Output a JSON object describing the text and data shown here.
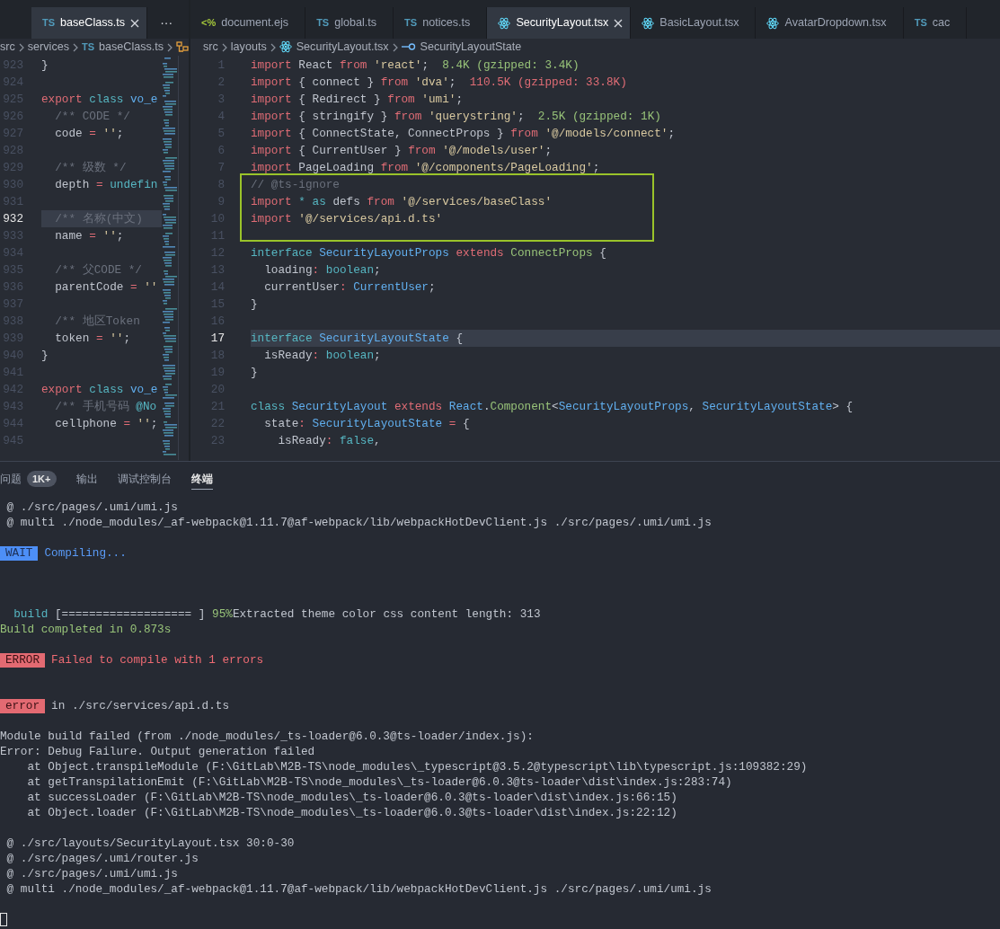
{
  "left_group": {
    "tabs": [
      {
        "label": "baseClass.ts",
        "icon": {
          "kind": "ts",
          "glyph": "TS"
        },
        "selected": true
      }
    ],
    "more_button": "···",
    "breadcrumb": [
      {
        "label": "src"
      },
      {
        "label": "services"
      },
      {
        "label": "baseClass.ts",
        "icon": {
          "kind": "ts",
          "glyph": "TS"
        }
      },
      {
        "icon": {
          "kind": "struct"
        }
      }
    ],
    "lines": [
      {
        "number": "923",
        "current": false,
        "tokens": [
          {
            "kind": "p",
            "text": "}"
          }
        ]
      },
      {
        "number": "924",
        "current": false
      },
      {
        "number": "925",
        "current": false,
        "tokens": [
          {
            "kind": "k",
            "text": "export"
          },
          {
            "kind": "c",
            "text": " class"
          },
          {
            "kind": "t",
            "text": " vo_e"
          }
        ]
      },
      {
        "number": "926",
        "current": false,
        "tokens": [
          {
            "kind": "cm",
            "text": "  /** CODE */"
          }
        ]
      },
      {
        "number": "927",
        "current": false,
        "tokens": [
          {
            "kind": "p",
            "text": "  code "
          },
          {
            "kind": "k",
            "text": "="
          },
          {
            "kind": "s",
            "text": " ''"
          },
          {
            "kind": "p",
            "text": ";"
          }
        ]
      },
      {
        "number": "928",
        "current": false
      },
      {
        "number": "929",
        "current": false,
        "tokens": [
          {
            "kind": "cm",
            "text": "  /** 级数 */"
          }
        ]
      },
      {
        "number": "930",
        "current": false,
        "tokens": [
          {
            "kind": "p",
            "text": "  depth "
          },
          {
            "kind": "k",
            "text": "="
          },
          {
            "kind": "c",
            "text": " undefin"
          }
        ]
      },
      {
        "number": "931",
        "current": false
      },
      {
        "number": "932",
        "current": true,
        "tokens": [
          {
            "kind": "cm",
            "text": "  /** 名称(中文)"
          }
        ]
      },
      {
        "number": "933",
        "current": false,
        "tokens": [
          {
            "kind": "p",
            "text": "  name "
          },
          {
            "kind": "k",
            "text": "="
          },
          {
            "kind": "s",
            "text": " ''"
          },
          {
            "kind": "p",
            "text": ";"
          }
        ]
      },
      {
        "number": "934",
        "current": false
      },
      {
        "number": "935",
        "current": false,
        "tokens": [
          {
            "kind": "cm",
            "text": "  /** 父CODE */"
          }
        ]
      },
      {
        "number": "936",
        "current": false,
        "tokens": [
          {
            "kind": "p",
            "text": "  parentCode "
          },
          {
            "kind": "k",
            "text": "="
          },
          {
            "kind": "s",
            "text": " ''"
          }
        ]
      },
      {
        "number": "937",
        "current": false
      },
      {
        "number": "938",
        "current": false,
        "tokens": [
          {
            "kind": "cm",
            "text": "  /** 地区Token"
          }
        ]
      },
      {
        "number": "939",
        "current": false,
        "tokens": [
          {
            "kind": "p",
            "text": "  token "
          },
          {
            "kind": "k",
            "text": "="
          },
          {
            "kind": "s",
            "text": " ''"
          },
          {
            "kind": "p",
            "text": ";"
          }
        ]
      },
      {
        "number": "940",
        "current": false,
        "tokens": [
          {
            "kind": "p",
            "text": "}"
          }
        ]
      },
      {
        "number": "941",
        "current": false
      },
      {
        "number": "942",
        "current": false,
        "tokens": [
          {
            "kind": "k",
            "text": "export"
          },
          {
            "kind": "c",
            "text": " class"
          },
          {
            "kind": "t",
            "text": " vo_e"
          }
        ]
      },
      {
        "number": "943",
        "current": false,
        "tokens": [
          {
            "kind": "cm",
            "text": "  /** 手机号码 "
          },
          {
            "kind": "c",
            "text": "@No"
          }
        ]
      },
      {
        "number": "944",
        "current": false,
        "tokens": [
          {
            "kind": "p",
            "text": "  cellphone "
          },
          {
            "kind": "k",
            "text": "="
          },
          {
            "kind": "s",
            "text": " ''"
          },
          {
            "kind": "p",
            "text": ";"
          }
        ]
      },
      {
        "number": "945",
        "current": false
      }
    ]
  },
  "right_group": {
    "tabs": [
      {
        "label": "document.ejs",
        "icon": {
          "kind": "ejs",
          "glyph": "<%"
        },
        "selected": false
      },
      {
        "label": "global.ts",
        "icon": {
          "kind": "ts",
          "glyph": "TS"
        },
        "selected": false
      },
      {
        "label": "notices.ts",
        "icon": {
          "kind": "ts",
          "glyph": "TS"
        },
        "selected": false
      },
      {
        "label": "SecurityLayout.tsx",
        "icon": {
          "kind": "react"
        },
        "selected": true
      },
      {
        "label": "BasicLayout.tsx",
        "icon": {
          "kind": "react"
        },
        "selected": false
      },
      {
        "label": "AvatarDropdown.tsx",
        "icon": {
          "kind": "react"
        },
        "selected": false
      },
      {
        "label": "cac",
        "icon": {
          "kind": "ts",
          "glyph": "TS"
        },
        "selected": false
      }
    ],
    "breadcrumb": [
      {
        "label": "src"
      },
      {
        "label": "layouts"
      },
      {
        "label": "SecurityLayout.tsx",
        "icon": {
          "kind": "react"
        }
      },
      {
        "label": "SecurityLayoutState",
        "icon": {
          "kind": "field"
        }
      }
    ],
    "lines": [
      {
        "kind": "line",
        "number": "1",
        "current": false,
        "tokens": [
          {
            "kind": "k",
            "text": "import"
          },
          {
            "kind": "p",
            "text": " React "
          },
          {
            "kind": "k",
            "text": "from"
          },
          {
            "kind": "s",
            "text": " 'react'"
          },
          {
            "kind": "p",
            "text": ";  "
          },
          {
            "kind": "sz",
            "text": "8.4K (gzipped: 3.4K)"
          }
        ]
      },
      {
        "kind": "line",
        "number": "2",
        "current": false,
        "tokens": [
          {
            "kind": "k",
            "text": "import"
          },
          {
            "kind": "p",
            "text": " { connect } "
          },
          {
            "kind": "k",
            "text": "from"
          },
          {
            "kind": "s",
            "text": " 'dva'"
          },
          {
            "kind": "p",
            "text": ";  "
          },
          {
            "kind": "szr",
            "text": "110.5K (gzipped: 33.8K)"
          }
        ]
      },
      {
        "kind": "line",
        "number": "3",
        "current": false,
        "tokens": [
          {
            "kind": "k",
            "text": "import"
          },
          {
            "kind": "p",
            "text": " { Redirect } "
          },
          {
            "kind": "k",
            "text": "from"
          },
          {
            "kind": "s",
            "text": " 'umi'"
          },
          {
            "kind": "p",
            "text": ";"
          }
        ]
      },
      {
        "kind": "line",
        "number": "4",
        "current": false,
        "tokens": [
          {
            "kind": "k",
            "text": "import"
          },
          {
            "kind": "p",
            "text": " { stringify } "
          },
          {
            "kind": "k",
            "text": "from"
          },
          {
            "kind": "s",
            "text": " 'querystring'"
          },
          {
            "kind": "p",
            "text": ";  "
          },
          {
            "kind": "sz",
            "text": "2.5K (gzipped: 1K)"
          }
        ]
      },
      {
        "kind": "line",
        "number": "5",
        "current": false,
        "tokens": [
          {
            "kind": "k",
            "text": "import"
          },
          {
            "kind": "p",
            "text": " { ConnectState, ConnectProps } "
          },
          {
            "kind": "k",
            "text": "from"
          },
          {
            "kind": "s",
            "text": " '@/models/connect'"
          },
          {
            "kind": "p",
            "text": ";"
          }
        ]
      },
      {
        "kind": "line",
        "number": "6",
        "current": false,
        "tokens": [
          {
            "kind": "k",
            "text": "import"
          },
          {
            "kind": "p",
            "text": " { CurrentUser } "
          },
          {
            "kind": "k",
            "text": "from"
          },
          {
            "kind": "s",
            "text": " '@/models/user'"
          },
          {
            "kind": "p",
            "text": ";"
          }
        ]
      },
      {
        "kind": "line",
        "number": "7",
        "current": false,
        "tokens": [
          {
            "kind": "k",
            "text": "import"
          },
          {
            "kind": "p",
            "text": " PageLoading "
          },
          {
            "kind": "k",
            "text": "from"
          },
          {
            "kind": "s",
            "text": " '@/components/PageLoading'"
          },
          {
            "kind": "p",
            "text": ";"
          }
        ]
      },
      {
        "kind": "boxed",
        "lines": [
          {
            "number": "8",
            "current": false,
            "tokens": [
              {
                "kind": "cm",
                "text": "// @ts-ignore"
              }
            ]
          },
          {
            "number": "9",
            "current": false,
            "tokens": [
              {
                "kind": "k",
                "text": "import"
              },
              {
                "kind": "c",
                "text": " *"
              },
              {
                "kind": "c",
                "text": " as"
              },
              {
                "kind": "p",
                "text": " defs "
              },
              {
                "kind": "k",
                "text": "from"
              },
              {
                "kind": "s",
                "text": " '@/services/baseClass'"
              }
            ]
          },
          {
            "number": "10",
            "current": false,
            "tokens": [
              {
                "kind": "k",
                "text": "import"
              },
              {
                "kind": "s",
                "text": " '@/services/api.d.ts'"
              }
            ]
          },
          {
            "number": "11",
            "current": false
          }
        ]
      },
      {
        "kind": "line",
        "number": "12",
        "current": false,
        "tokens": [
          {
            "kind": "c",
            "text": "interface"
          },
          {
            "kind": "t",
            "text": " SecurityLayoutProps"
          },
          {
            "kind": "k",
            "text": " extends"
          },
          {
            "kind": "g",
            "text": " ConnectProps"
          },
          {
            "kind": "p",
            "text": " {"
          }
        ]
      },
      {
        "kind": "line",
        "number": "13",
        "current": false,
        "tokens": [
          {
            "kind": "p",
            "text": "  loading"
          },
          {
            "kind": "k",
            "text": ":"
          },
          {
            "kind": "b",
            "text": " boolean"
          },
          {
            "kind": "p",
            "text": ";"
          }
        ]
      },
      {
        "kind": "line",
        "number": "14",
        "current": false,
        "tokens": [
          {
            "kind": "p",
            "text": "  currentUser"
          },
          {
            "kind": "k",
            "text": ":"
          },
          {
            "kind": "t",
            "text": " CurrentUser"
          },
          {
            "kind": "p",
            "text": ";"
          }
        ]
      },
      {
        "kind": "line",
        "number": "15",
        "current": false,
        "tokens": [
          {
            "kind": "p",
            "text": "}"
          }
        ]
      },
      {
        "kind": "line",
        "number": "16",
        "current": false
      },
      {
        "kind": "line",
        "number": "17",
        "current": true,
        "tokens": [
          {
            "kind": "c",
            "text": "interface"
          },
          {
            "kind": "t",
            "text": " SecurityLayoutState"
          },
          {
            "kind": "p",
            "text": " {"
          }
        ]
      },
      {
        "kind": "line",
        "number": "18",
        "current": false,
        "tokens": [
          {
            "kind": "p",
            "text": "  isReady"
          },
          {
            "kind": "k",
            "text": ":"
          },
          {
            "kind": "b",
            "text": " boolean"
          },
          {
            "kind": "p",
            "text": ";"
          }
        ]
      },
      {
        "kind": "line",
        "number": "19",
        "current": false,
        "tokens": [
          {
            "kind": "p",
            "text": "}"
          }
        ]
      },
      {
        "kind": "line",
        "number": "20",
        "current": false
      },
      {
        "kind": "line",
        "number": "21",
        "current": false,
        "tokens": [
          {
            "kind": "c",
            "text": "class"
          },
          {
            "kind": "t",
            "text": " SecurityLayout"
          },
          {
            "kind": "k",
            "text": " extends"
          },
          {
            "kind": "t",
            "text": " React"
          },
          {
            "kind": "p",
            "text": "."
          },
          {
            "kind": "g",
            "text": "Component"
          },
          {
            "kind": "p",
            "text": "<"
          },
          {
            "kind": "t",
            "text": "SecurityLayoutProps"
          },
          {
            "kind": "p",
            "text": ", "
          },
          {
            "kind": "t",
            "text": "SecurityLayoutState"
          },
          {
            "kind": "p",
            "text": "> {"
          }
        ]
      },
      {
        "kind": "line",
        "number": "22",
        "current": false,
        "tokens": [
          {
            "kind": "p",
            "text": "  state"
          },
          {
            "kind": "k",
            "text": ":"
          },
          {
            "kind": "t",
            "text": " SecurityLayoutState"
          },
          {
            "kind": "k",
            "text": " ="
          },
          {
            "kind": "p",
            "text": " {"
          }
        ]
      },
      {
        "kind": "line",
        "number": "23",
        "current": false,
        "tokens": [
          {
            "kind": "p",
            "text": "    isReady"
          },
          {
            "kind": "k",
            "text": ":"
          },
          {
            "kind": "b",
            "text": " false"
          },
          {
            "kind": "p",
            "text": ","
          }
        ]
      }
    ]
  },
  "panel": {
    "tabs": [
      {
        "label": "问题",
        "badge": "1K+",
        "selected": false
      },
      {
        "label": "输出",
        "selected": false
      },
      {
        "label": "调试控制台",
        "selected": false
      },
      {
        "label": "终端",
        "selected": true
      }
    ],
    "terminal_lines": [
      {
        "kind": "text",
        "tokens": [
          {
            "kind": "p",
            "text": " @ ./src/pages/.umi/umi.js"
          }
        ]
      },
      {
        "kind": "text",
        "tokens": [
          {
            "kind": "p",
            "text": " @ multi ./node_modules/_af-webpack@1.11.7@af-webpack/lib/webpackHotDevClient.js ./src/pages/.umi/umi.js"
          }
        ]
      },
      {
        "kind": "blank"
      },
      {
        "kind": "tagged",
        "tag": {
          "kind": "info",
          "text": "WAIT"
        },
        "tokens": [
          {
            "kind": "info",
            "text": "Compiling..."
          }
        ]
      },
      {
        "kind": "blank"
      },
      {
        "kind": "blank"
      },
      {
        "kind": "blank"
      },
      {
        "kind": "text",
        "tokens": [
          {
            "kind": "cyan",
            "text": "  build"
          },
          {
            "kind": "p",
            "text": " [=================== ] "
          },
          {
            "kind": "green",
            "text": "95%"
          },
          {
            "kind": "p",
            "text": "Extracted theme color css content length: 313"
          }
        ]
      },
      {
        "kind": "text",
        "tokens": [
          {
            "kind": "green",
            "text": "Build completed in 0.873s"
          }
        ]
      },
      {
        "kind": "blank"
      },
      {
        "kind": "tagged",
        "tag": {
          "kind": "error",
          "text": "ERROR"
        },
        "tokens": [
          {
            "kind": "err",
            "text": "Failed to compile with 1 errors"
          }
        ]
      },
      {
        "kind": "blank"
      },
      {
        "kind": "blank"
      },
      {
        "kind": "tagged",
        "tag": {
          "kind": "error",
          "text": "error"
        },
        "tokens": [
          {
            "kind": "p",
            "text": "in ./src/services/api.d.ts"
          }
        ]
      },
      {
        "kind": "blank"
      },
      {
        "kind": "text",
        "tokens": [
          {
            "kind": "p",
            "text": "Module build failed (from ./node_modules/_ts-loader@6.0.3@ts-loader/index.js):"
          }
        ]
      },
      {
        "kind": "text",
        "tokens": [
          {
            "kind": "p",
            "text": "Error: Debug Failure. Output generation failed"
          }
        ]
      },
      {
        "kind": "text",
        "tokens": [
          {
            "kind": "p",
            "text": "    at Object.transpileModule (F:\\GitLab\\M2B-TS\\node_modules\\_typescript@3.5.2@typescript\\lib\\typescript.js:109382:29)"
          }
        ]
      },
      {
        "kind": "text",
        "tokens": [
          {
            "kind": "p",
            "text": "    at getTranspilationEmit (F:\\GitLab\\M2B-TS\\node_modules\\_ts-loader@6.0.3@ts-loader\\dist\\index.js:283:74)"
          }
        ]
      },
      {
        "kind": "text",
        "tokens": [
          {
            "kind": "p",
            "text": "    at successLoader (F:\\GitLab\\M2B-TS\\node_modules\\_ts-loader@6.0.3@ts-loader\\dist\\index.js:66:15)"
          }
        ]
      },
      {
        "kind": "text",
        "tokens": [
          {
            "kind": "p",
            "text": "    at Object.loader (F:\\GitLab\\M2B-TS\\node_modules\\_ts-loader@6.0.3@ts-loader\\dist\\index.js:22:12)"
          }
        ]
      },
      {
        "kind": "blank"
      },
      {
        "kind": "text",
        "tokens": [
          {
            "kind": "p",
            "text": " @ ./src/layouts/SecurityLayout.tsx 30:0-30"
          }
        ]
      },
      {
        "kind": "text",
        "tokens": [
          {
            "kind": "p",
            "text": " @ ./src/pages/.umi/router.js"
          }
        ]
      },
      {
        "kind": "text",
        "tokens": [
          {
            "kind": "p",
            "text": " @ ./src/pages/.umi/umi.js"
          }
        ]
      },
      {
        "kind": "text",
        "tokens": [
          {
            "kind": "p",
            "text": " @ multi ./node_modules/_af-webpack@1.11.7@af-webpack/lib/webpackHotDevClient.js ./src/pages/.umi/umi.js"
          }
        ]
      },
      {
        "kind": "blank"
      },
      {
        "kind": "cursor"
      }
    ]
  }
}
